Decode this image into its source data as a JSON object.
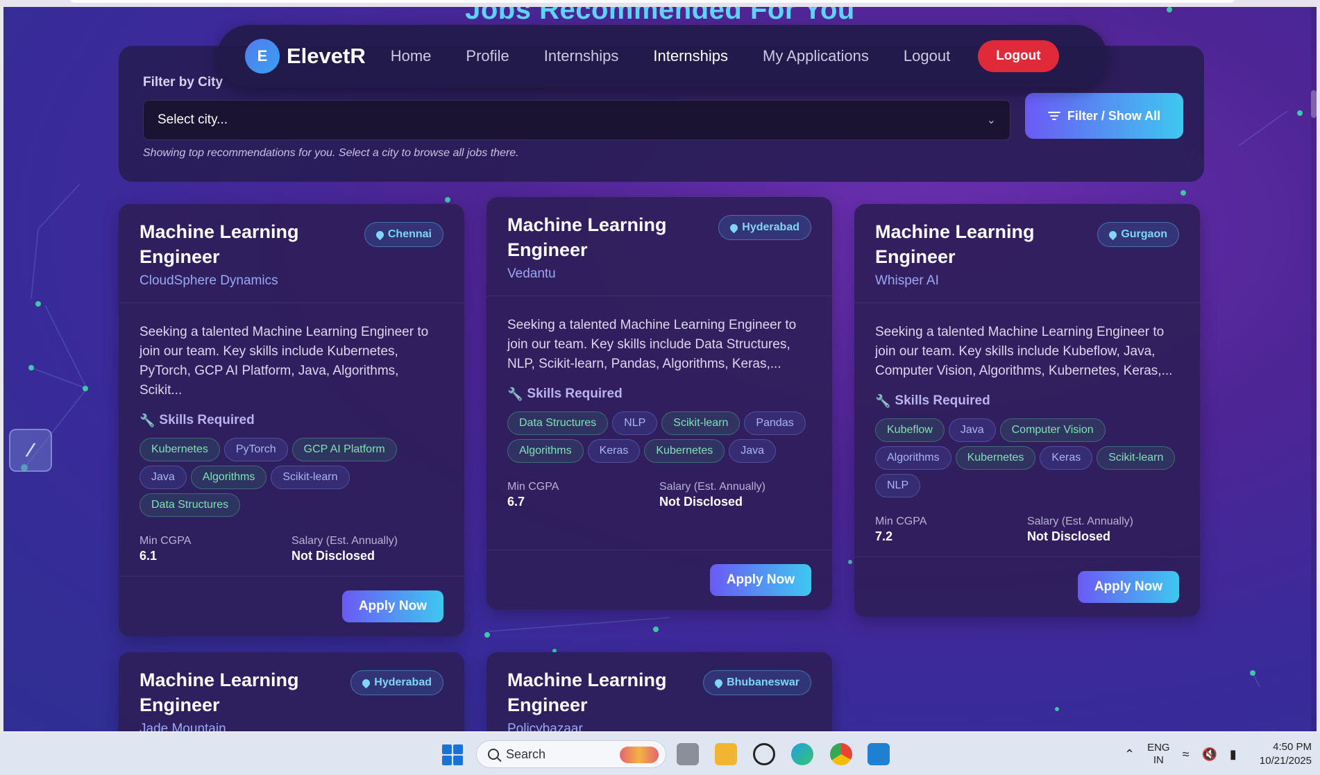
{
  "page": {
    "heading": "Jobs Recommended For You"
  },
  "navbar": {
    "logo_letter": "E",
    "brand": "ElevetR",
    "links": [
      {
        "label": "Home",
        "active": false
      },
      {
        "label": "Profile",
        "active": false
      },
      {
        "label": "Internships",
        "active": false
      },
      {
        "label": "Internships",
        "active": true
      },
      {
        "label": "My Applications",
        "active": false
      },
      {
        "label": "Logout",
        "active": false
      }
    ],
    "logout_button": "Logout"
  },
  "filter": {
    "label": "Filter by City",
    "select_placeholder": "Select city...",
    "button": "Filter / Show All",
    "hint": "Showing top recommendations for you. Select a city to browse all jobs there."
  },
  "labels": {
    "skills_heading": "Skills Required",
    "min_cgpa": "Min CGPA",
    "salary": "Salary (Est. Annually)",
    "apply": "Apply Now"
  },
  "jobs": [
    {
      "title": "Machine Learning Engineer",
      "company": "CloudSphere Dynamics",
      "city": "Chennai",
      "description": "Seeking a talented Machine Learning Engineer to join our team. Key skills include Kubernetes, PyTorch, GCP AI Platform, Java, Algorithms, Scikit...",
      "skills": [
        "Kubernetes",
        "PyTorch",
        "GCP AI Platform",
        "Java",
        "Algorithms",
        "Scikit-learn",
        "Data Structures"
      ],
      "min_cgpa": "6.1",
      "salary": "Not Disclosed"
    },
    {
      "title": "Machine Learning Engineer",
      "company": "Vedantu",
      "city": "Hyderabad",
      "description": "Seeking a talented Machine Learning Engineer to join our team. Key skills include Data Structures, NLP, Scikit-learn, Pandas, Algorithms, Keras,...",
      "skills": [
        "Data Structures",
        "NLP",
        "Scikit-learn",
        "Pandas",
        "Algorithms",
        "Keras",
        "Kubernetes",
        "Java"
      ],
      "min_cgpa": "6.7",
      "salary": "Not Disclosed"
    },
    {
      "title": "Machine Learning Engineer",
      "company": "Whisper AI",
      "city": "Gurgaon",
      "description": "Seeking a talented Machine Learning Engineer to join our team. Key skills include Kubeflow, Java, Computer Vision, Algorithms, Kubernetes, Keras,...",
      "skills": [
        "Kubeflow",
        "Java",
        "Computer Vision",
        "Algorithms",
        "Kubernetes",
        "Keras",
        "Scikit-learn",
        "NLP"
      ],
      "min_cgpa": "7.2",
      "salary": "Not Disclosed"
    },
    {
      "title": "Machine Learning Engineer",
      "company": "Jade Mountain",
      "city": "Hyderabad"
    },
    {
      "title": "Machine Learning Engineer",
      "company": "Policybazaar",
      "city": "Bhubaneswar"
    }
  ],
  "taskbar": {
    "search": "Search",
    "lang_top": "ENG",
    "lang_bottom": "IN",
    "time": "4:50 PM",
    "date": "10/21/2025"
  },
  "colors": {
    "accent_start": "#6a5af5",
    "accent_end": "#3ec8f0",
    "logout_red": "#e02a3a",
    "skill_green": "#7ee3b6",
    "skill_blue": "#aab6f8"
  }
}
